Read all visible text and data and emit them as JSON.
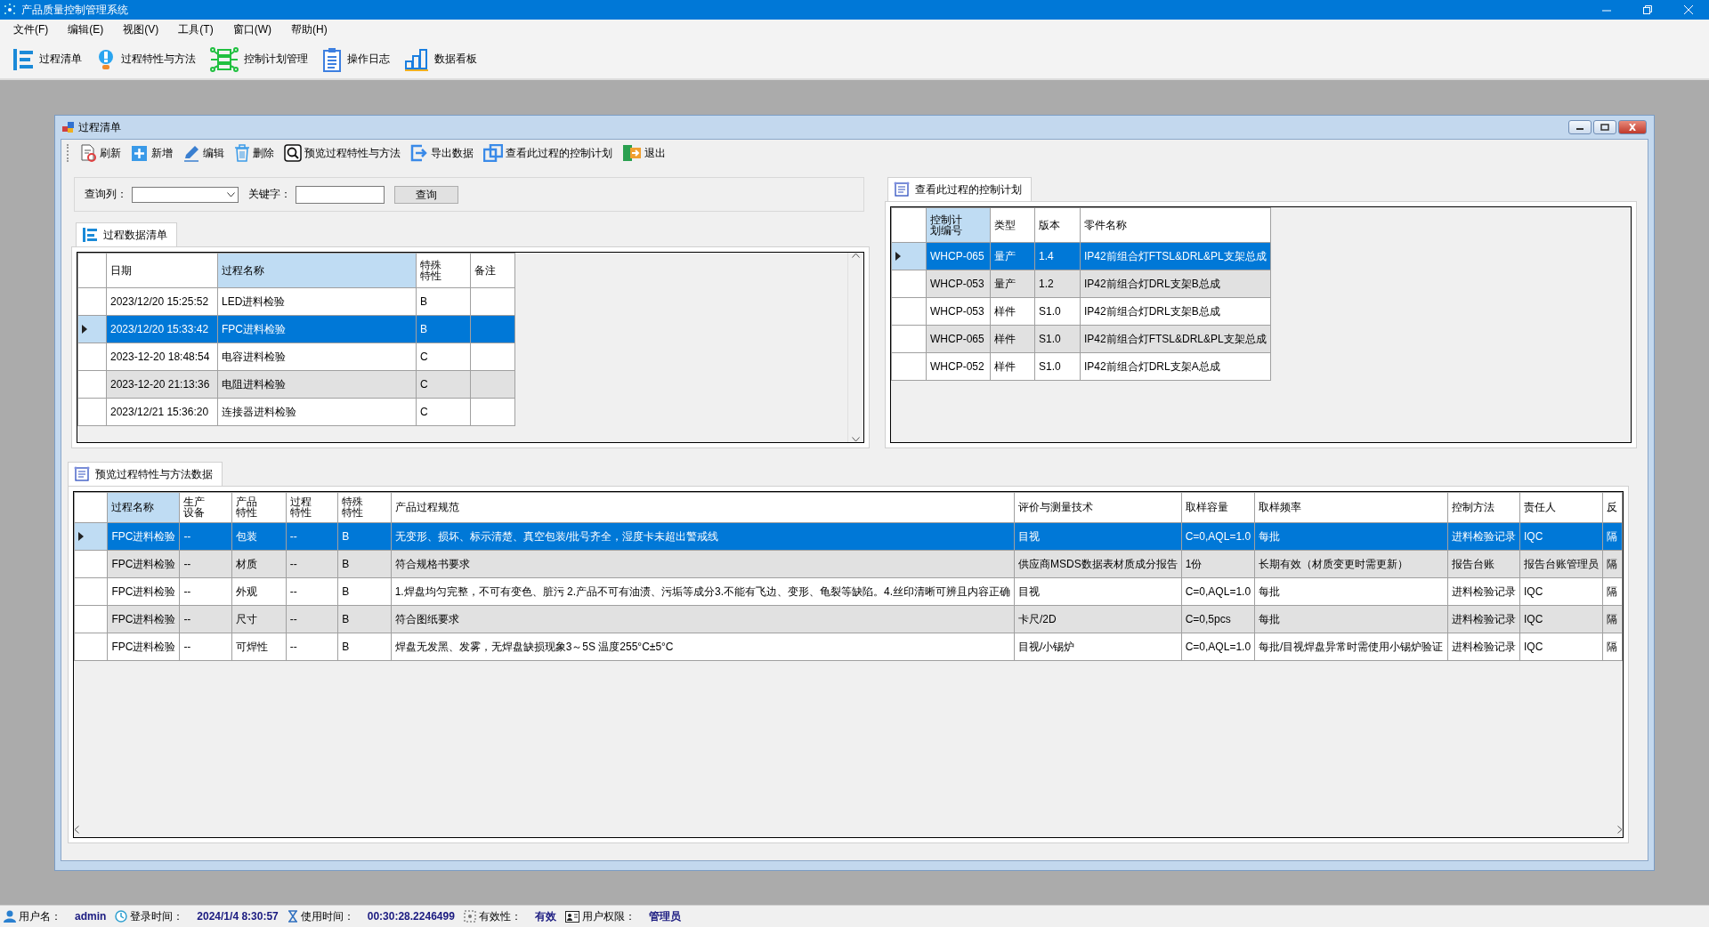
{
  "window": {
    "title": "产品质量控制管理系统"
  },
  "menu": [
    "文件(F)",
    "编辑(E)",
    "视图(V)",
    "工具(T)",
    "窗口(W)",
    "帮助(H)"
  ],
  "toolbar": [
    {
      "kind": "list",
      "label": "过程清单"
    },
    {
      "kind": "bulb",
      "label": "过程特性与方法"
    },
    {
      "kind": "network",
      "label": "控制计划管理"
    },
    {
      "kind": "log",
      "label": "操作日志"
    },
    {
      "kind": "chart",
      "label": "数据看板"
    }
  ],
  "child_window": {
    "title": "过程清单",
    "toolbar": [
      {
        "kind": "refresh",
        "label": "刷新"
      },
      {
        "kind": "add",
        "label": "新增"
      },
      {
        "kind": "edit",
        "label": "编辑"
      },
      {
        "kind": "delete",
        "label": "删除"
      },
      {
        "kind": "preview",
        "label": "预览过程特性与方法"
      },
      {
        "kind": "export",
        "label": "导出数据"
      },
      {
        "kind": "plan",
        "label": "查看此过程的控制计划"
      },
      {
        "kind": "exit",
        "label": "退出"
      }
    ],
    "query": {
      "column_label": "查询列：",
      "keyword_label": "关键字：",
      "button": "查询"
    },
    "process_list": {
      "tab": {
        "label": "过程数据清单",
        "selected": true
      },
      "columns": [
        {
          "label": "日期",
          "current": false
        },
        {
          "label": "过程名称",
          "current": true
        },
        {
          "label": "特殊特性",
          "current": false
        },
        {
          "label": "备注",
          "current": false
        }
      ],
      "rows": [
        {
          "selected": false,
          "cells": [
            "2023/12/20 15:25:52",
            "LED进料检验",
            "B",
            ""
          ]
        },
        {
          "selected": true,
          "cells": [
            "2023/12/20 15:33:42",
            "FPC进料检验",
            "B",
            ""
          ]
        },
        {
          "selected": false,
          "cells": [
            "2023-12-20 18:48:54",
            "电容进料检验",
            "C",
            ""
          ]
        },
        {
          "selected": false,
          "cells": [
            "2023-12-20 21:13:36",
            "电阻进料检验",
            "C",
            ""
          ]
        },
        {
          "selected": false,
          "cells": [
            "2023/12/21 15:36:20",
            "连接器进料检验",
            "C",
            ""
          ]
        }
      ]
    },
    "control_plans": {
      "tab": {
        "label": "查看此过程的控制计划",
        "selected": true
      },
      "columns": [
        {
          "label": "控制计划编号",
          "current": true
        },
        {
          "label": "类型",
          "current": false
        },
        {
          "label": "版本",
          "current": false
        },
        {
          "label": "零件名称",
          "current": false
        }
      ],
      "rows": [
        {
          "selected": true,
          "cells": [
            "WHCP-065",
            "量产",
            "1.4",
            "IP42前组合灯FTSL&DRL&PL支架总成"
          ]
        },
        {
          "selected": false,
          "cells": [
            "WHCP-053",
            "量产",
            "1.2",
            "IP42前组合灯DRL支架B总成"
          ]
        },
        {
          "selected": false,
          "cells": [
            "WHCP-053",
            "样件",
            "S1.0",
            "IP42前组合灯DRL支架B总成"
          ]
        },
        {
          "selected": false,
          "cells": [
            "WHCP-065",
            "样件",
            "S1.0",
            "IP42前组合灯FTSL&DRL&PL支架总成"
          ]
        },
        {
          "selected": false,
          "cells": [
            "WHCP-052",
            "样件",
            "S1.0",
            "IP42前组合灯DRL支架A总成"
          ]
        }
      ]
    },
    "characteristics": {
      "tab": {
        "label": "预览过程特性与方法数据",
        "selected": true
      },
      "columns": [
        {
          "label": "过程名称",
          "current": true
        },
        {
          "label": "生产设备",
          "current": false
        },
        {
          "label": "产品特性",
          "current": false
        },
        {
          "label": "过程特性",
          "current": false
        },
        {
          "label": "特殊特性",
          "current": false
        },
        {
          "label": "产品过程规范",
          "current": false
        },
        {
          "label": "评价与测量技术",
          "current": false
        },
        {
          "label": "取样容量",
          "current": false
        },
        {
          "label": "取样频率",
          "current": false
        },
        {
          "label": "控制方法",
          "current": false
        },
        {
          "label": "责任人",
          "current": false
        },
        {
          "label": "反",
          "current": false
        }
      ],
      "rows": [
        {
          "selected": true,
          "cells": [
            "FPC进料检验",
            "--",
            "包装",
            "--",
            "B",
            "无变形、损坏、标示清楚、真空包装/批号齐全，湿度卡未超出警戒线",
            "目视",
            "C=0,AQL=1.0",
            "每批",
            "进料检验记录",
            "IQC",
            "隔"
          ]
        },
        {
          "selected": false,
          "cells": [
            "FPC进料检验",
            "--",
            "材质",
            "--",
            "B",
            "符合规格书要求",
            "供应商MSDS数据表材质成分报告",
            "1份",
            "长期有效（材质变更时需更新）",
            "报告台账",
            "报告台账管理员",
            "隔"
          ]
        },
        {
          "selected": false,
          "cells": [
            "FPC进料检验",
            "--",
            "外观",
            "--",
            "B",
            "1.焊盘均匀完整，不可有变色、脏污 2.产品不可有油渍、污垢等成分3.不能有飞边、变形、龟裂等缺陷。4.丝印清晰可辨且内容正确",
            "目视",
            "C=0,AQL=1.0",
            "每批",
            "进料检验记录",
            "IQC",
            "隔"
          ]
        },
        {
          "selected": false,
          "cells": [
            "FPC进料检验",
            "--",
            "尺寸",
            "--",
            "B",
            "符合图纸要求",
            "卡尺/2D",
            "C=0,5pcs",
            "每批",
            "进料检验记录",
            "IQC",
            "隔"
          ]
        },
        {
          "selected": false,
          "cells": [
            "FPC进料检验",
            "--",
            "可焊性",
            "--",
            "B",
            "焊盘无发黑、发雾，无焊盘缺损现象3～5S 温度255°C±5°C",
            "目视/小锡炉",
            "C=0,AQL=1.0",
            "每批/目视焊盘异常时需使用小锡炉验证",
            "进料检验记录",
            "IQC",
            "隔"
          ]
        }
      ]
    }
  },
  "status_bar": [
    {
      "kind": "user",
      "label": "用户名：",
      "value": "admin"
    },
    {
      "kind": "login",
      "label": "登录时间：",
      "value": "2024/1/4 8:30:57"
    },
    {
      "kind": "timer",
      "label": "使用时间：",
      "value": "00:30:28.2246499"
    },
    {
      "kind": "valid",
      "label": "有效性：",
      "value": "有效"
    },
    {
      "kind": "role",
      "label": "用户权限：",
      "value": "管理员"
    }
  ]
}
